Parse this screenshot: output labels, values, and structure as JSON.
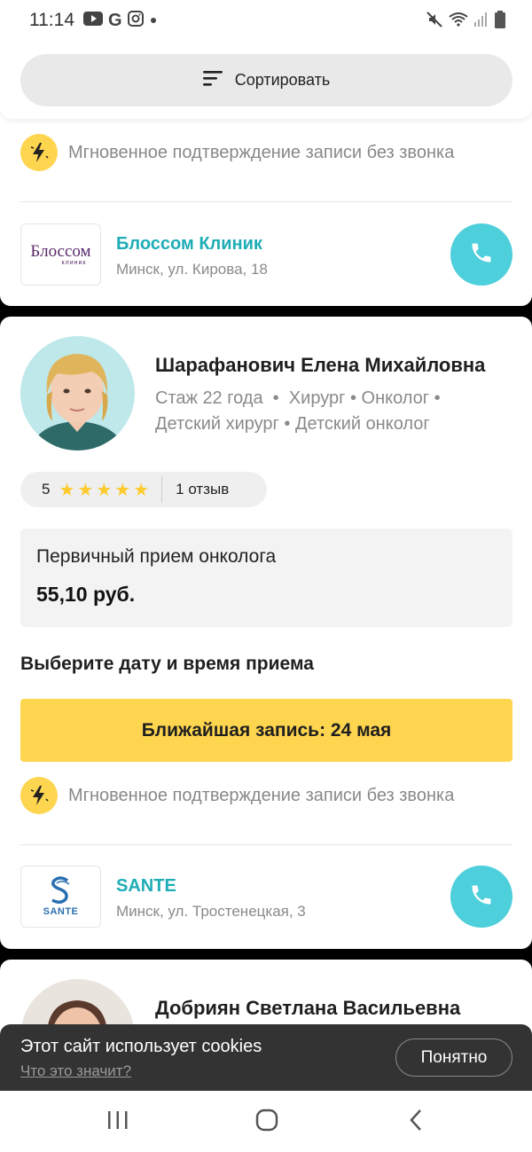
{
  "status_bar": {
    "time": "11:14",
    "left_icons": [
      "youtube-icon",
      "google-icon",
      "instagram-icon",
      "dot-icon"
    ],
    "right_icons": [
      "mute-icon",
      "wifi-icon",
      "signal-icon",
      "battery-icon"
    ]
  },
  "toolbar": {
    "sort_label": "Сортировать"
  },
  "instant_confirm": "Мгновенное подтверждение записи без звонка",
  "clinics": [
    {
      "logo_text": "Блоссом",
      "logo_subtext": "клиник",
      "name": "Блоссом Клиник",
      "address": "Минск, ул. Кирова, 18"
    },
    {
      "logo_text": "SANTE",
      "name": "SANTE",
      "address": "Минск, ул. Тростенецкая, 3"
    }
  ],
  "doctor": {
    "name": "Шарафанович Елена Михайловна",
    "meta_line1": "Стаж 22 года  •  Хирург • Онколог •",
    "meta_line2": "Детский хирург • Детский онколог",
    "rating": "5",
    "stars": 5,
    "reviews": "1 отзыв",
    "service_title": "Первичный прием онколога",
    "price": "55,10 руб.",
    "choose_label": "Выберите дату и время приема",
    "nearest_label": "Ближайшая запись: 24 мая"
  },
  "doctor2": {
    "name": "Добриян Светлана Васильевна"
  },
  "cookie": {
    "text": "Этот сайт использует cookies",
    "link": "Что это значит?",
    "button": "Понятно"
  },
  "colors": {
    "accent_yellow": "#fed54f",
    "teal": "#1eadb6",
    "call_button": "#4dcfdc",
    "star": "#fecb2e"
  }
}
